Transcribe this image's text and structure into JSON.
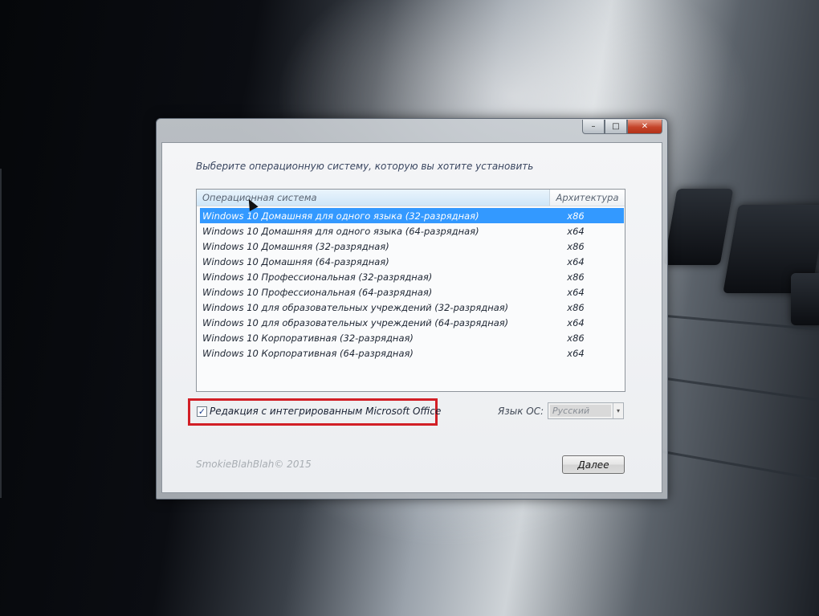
{
  "window": {
    "controls": {
      "minimize": "–",
      "maximize": "□",
      "close": "✕"
    },
    "prompt": "Выберите операционную систему, которую вы хотите установить"
  },
  "list": {
    "headers": {
      "os": "Операционная система",
      "arch": "Архитектура"
    },
    "rows": [
      {
        "os": "Windows 10 Домашняя для одного языка (32-разрядная)",
        "arch": "x86",
        "selected": true
      },
      {
        "os": "Windows 10 Домашняя для одного языка (64-разрядная)",
        "arch": "x64"
      },
      {
        "os": "Windows 10 Домашняя (32-разрядная)",
        "arch": "x86"
      },
      {
        "os": "Windows 10 Домашняя (64-разрядная)",
        "arch": "x64"
      },
      {
        "os": "Windows 10 Профессиональная (32-разрядная)",
        "arch": "x86"
      },
      {
        "os": "Windows 10 Профессиональная (64-разрядная)",
        "arch": "x64"
      },
      {
        "os": "Windows 10 для образовательных учреждений (32-разрядная)",
        "arch": "x86"
      },
      {
        "os": "Windows 10 для образовательных учреждений (64-разрядная)",
        "arch": "x64"
      },
      {
        "os": "Windows 10 Корпоративная (32-разрядная)",
        "arch": "x86"
      },
      {
        "os": "Windows 10 Корпоративная (64-разрядная)",
        "arch": "x64"
      }
    ]
  },
  "options": {
    "office_checkbox": {
      "label": "Редакция с интегрированным Microsoft Office",
      "checked": true,
      "mark": "✓"
    },
    "language": {
      "label": "Язык ОС:",
      "value": "Русский",
      "arrow": "▾"
    }
  },
  "footer": {
    "copyright": "SmokieBlahBlah© 2015",
    "next_label": "Далее"
  },
  "colors": {
    "selection": "#3399ff",
    "highlight_box": "#d21f26"
  }
}
